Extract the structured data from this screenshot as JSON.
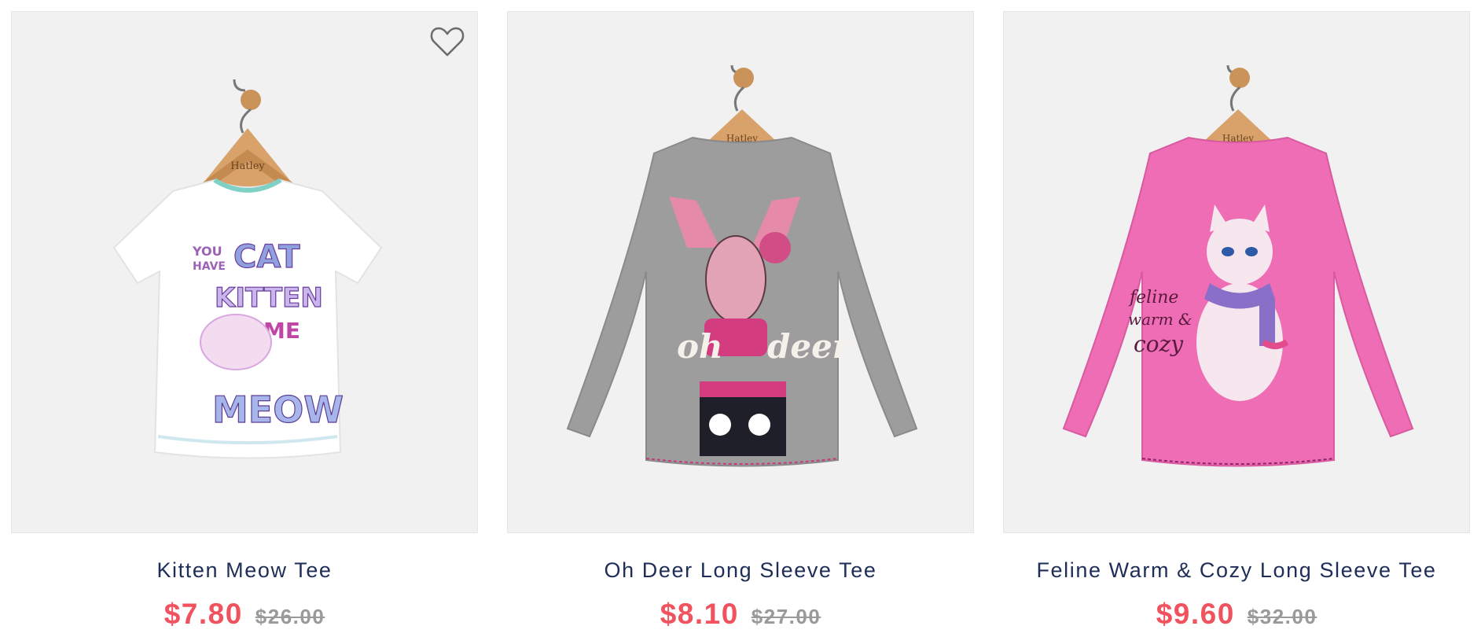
{
  "products": [
    {
      "name": "Kitten Meow Tee",
      "sale_price": "$7.80",
      "original_price": "$26.00",
      "shirt_color": "#ffffff",
      "graphic_words": [
        "YOU",
        "HAVE",
        "CAT",
        "KITTEN",
        "ME",
        "MEOW"
      ],
      "hanger_brand": "Hatley",
      "wishlist_icon": "heart-outline-icon"
    },
    {
      "name": "Oh Deer Long Sleeve Tee",
      "sale_price": "$8.10",
      "original_price": "$27.00",
      "shirt_color": "#9d9d9d",
      "graphic_words": [
        "oh",
        "deer"
      ],
      "hanger_brand": "Hatley"
    },
    {
      "name": "Feline Warm & Cozy Long Sleeve Tee",
      "sale_price": "$9.60",
      "original_price": "$32.00",
      "shirt_color": "#ef6db4",
      "graphic_words": [
        "feline",
        "warm &",
        "cozy"
      ],
      "hanger_brand": "Hatley"
    }
  ],
  "colors": {
    "name_text": "#1e2e58",
    "sale_price": "#f0525e",
    "original_price": "#9a9a9a",
    "image_bg": "#f1f1f1"
  }
}
